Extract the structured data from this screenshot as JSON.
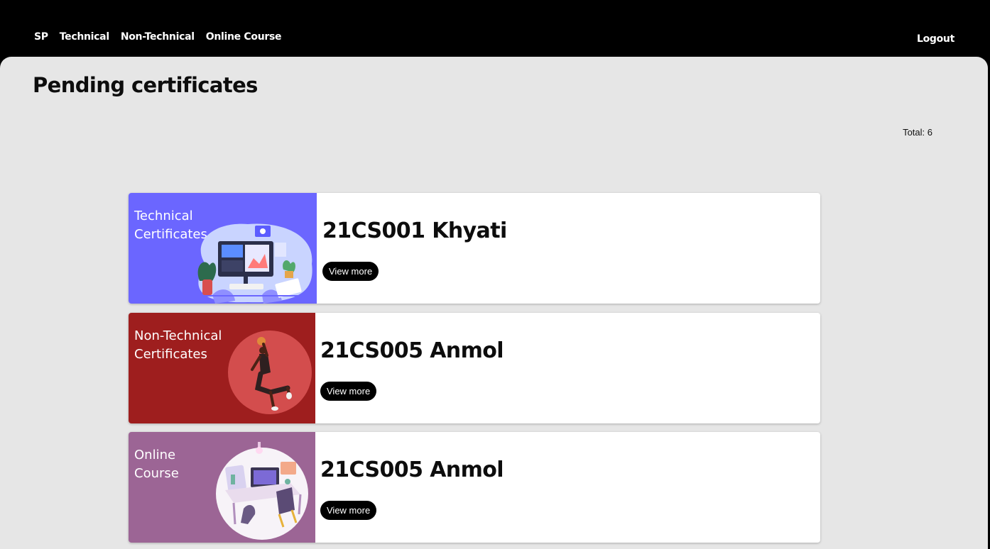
{
  "nav": {
    "links": [
      "SP",
      "Technical",
      "Non-Technical",
      "Online Course"
    ],
    "logout": "Logout"
  },
  "page": {
    "title": "Pending certificates",
    "total": "Total: 6"
  },
  "colors": {
    "technical": "#6b66ff",
    "nontechnical": "#9e1e1e",
    "online": "#9c6595"
  },
  "cards": [
    {
      "category": "Technical Certificates",
      "title": "21CS001 Khyati",
      "button": "View more"
    },
    {
      "category": "Non-Technical Certificates",
      "title": "21CS005 Anmol",
      "button": "View more"
    },
    {
      "category": "Online Course",
      "title": "21CS005 Anmol",
      "button": "View more"
    }
  ]
}
